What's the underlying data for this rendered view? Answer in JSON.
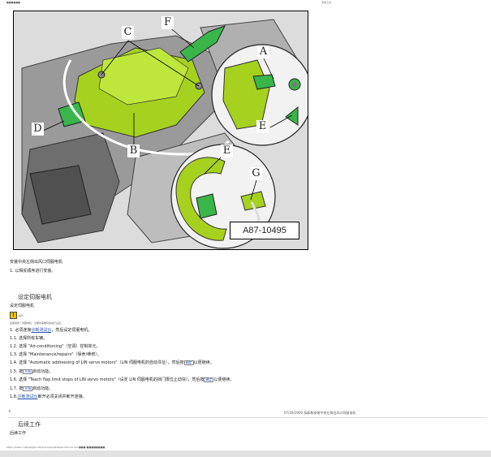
{
  "topbar": {
    "left": "■■■■■■",
    "right": "专用工具"
  },
  "figure": {
    "callouts": [
      "C",
      "F",
      "A",
      "D",
      "E",
      "B",
      "E",
      "G"
    ],
    "code": "A87-10495"
  },
  "install": {
    "heading": "安装中央左侧出风口伺服电机",
    "step": "1. 以相反顺序进行安装。"
  },
  "setting": {
    "title": "设定伺服电机",
    "subtitle": "设定伺服电机",
    "note_label": "提示",
    "note_text": "如需更换了伺服电机，必要时需要机械进行设定。",
    "steps": [
      {
        "pre": "1. 必须连接",
        "ref": "诊断测试仪",
        "post": "，然后设定伺服电机。"
      },
      {
        "pre": "1.1. 选择所有车辆。",
        "ref": "",
        "post": ""
      },
      {
        "pre": "1.2. 选择 \"Air-conditioning\"（空调）控制单元。",
        "ref": "",
        "post": ""
      },
      {
        "pre": "1.3. 选择 \"Maintenance/repairs\"（保养/维修）。",
        "ref": "",
        "post": ""
      },
      {
        "pre": "1.4. 选择 \"Automatic addressing of LIN servo motors\"（LIN 伺服电机的自动寻址），然后按",
        "ref": "确定",
        "post": "以便继续。"
      },
      {
        "pre": "1.5. 按",
        "ref": "开始",
        "post": "启动功能。"
      },
      {
        "pre": "1.6. 选择 \"Teach flap limit stops of LIN servo motors\"（设定 LIN 伺服电机的挡门限位止动块），然后按",
        "ref": "确定",
        "post": "以便继续。"
      },
      {
        "pre": "1.7. 按",
        "ref": "开始",
        "post": "启动功能。"
      },
      {
        "pre": "1.8.",
        "ref": "诊断测试仪",
        "post": "断开必须关闭并断开连接。"
      }
    ]
  },
  "nav": {
    "back": "‹",
    "page_title": "07/29/1900  拆卸和安装中央左侧出风口伺服电机"
  },
  "after": {
    "title": "后续工作",
    "subtitle": "后续工作"
  },
  "footer": {
    "url": "https://erwin.volkswagen.de/erwin/showHelpScreen.do?id=■■■-■■■■■■■■"
  }
}
